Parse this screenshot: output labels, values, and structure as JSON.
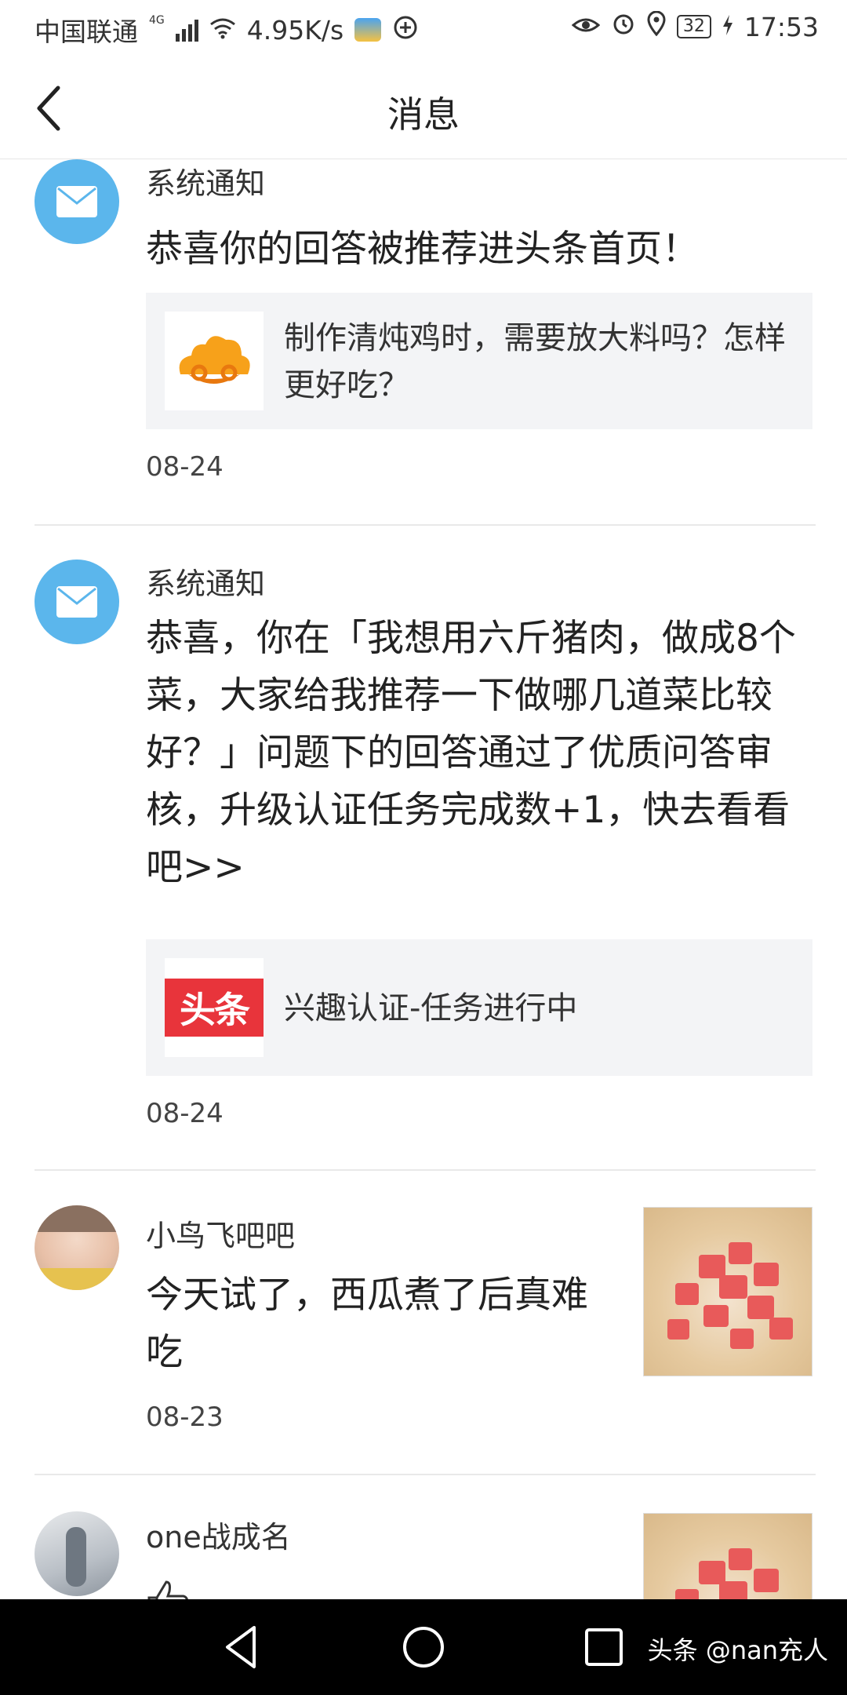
{
  "status_bar": {
    "carrier": "中国联通",
    "network": "4G",
    "speed": "4.95K/s",
    "battery": "32",
    "time": "17:53"
  },
  "header": {
    "title": "消息",
    "back_icon": "chevron-left-icon"
  },
  "messages": [
    {
      "type": "system",
      "avatar_icon": "mail-icon",
      "sender": "系统通知",
      "text": "恭喜你的回答被推荐进头条首页！",
      "card": {
        "thumb_icon": "cloud-logo-icon",
        "text": "制作清炖鸡时，需要放大料吗？怎样更好吃？"
      },
      "date": "08-24"
    },
    {
      "type": "system",
      "avatar_icon": "mail-icon",
      "sender": "系统通知",
      "text": "恭喜，你在「我想用六斤猪肉，做成8个菜，大家给我推荐一下做哪几道菜比较好？」问题下的回答通过了优质问答审核，升级认证任务完成数+1，快去看看吧>>",
      "card": {
        "thumb_label": "头条",
        "text": "兴趣认证-任务进行中"
      },
      "date": "08-24"
    },
    {
      "type": "comment",
      "sender": "小鸟飞吧吧",
      "text": "今天试了，西瓜煮了后真难吃",
      "date": "08-23"
    },
    {
      "type": "like",
      "sender": "one战成名",
      "text_icon": "thumbs-up-icon"
    }
  ],
  "bottom_nav": {
    "buttons": [
      "back-triangle-icon",
      "home-circle-icon",
      "recent-square-icon"
    ],
    "watermark": "头条 @nan充人"
  },
  "colors": {
    "mail_avatar": "#5bb6ec",
    "card_bg": "#f3f4f6",
    "toutiao_red": "#e8343b"
  }
}
